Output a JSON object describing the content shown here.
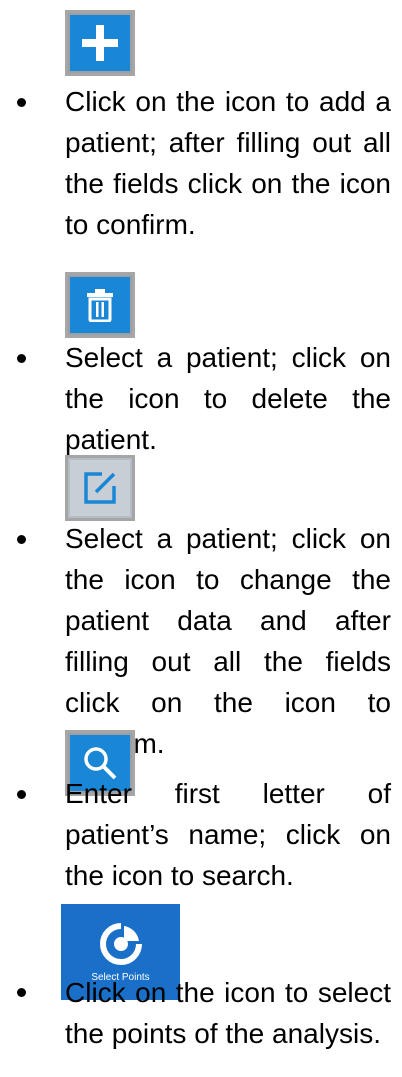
{
  "colors": {
    "icon_blue": "#1a87d6",
    "icon_blue_dark": "#1a6fc9",
    "icon_border": "#a6a6a6",
    "icon_light_bg": "#c7ced6"
  },
  "items": [
    {
      "icon": "plus-icon",
      "text": "Click on the icon to add a patient; after filling out all the fields click on the icon to confirm."
    },
    {
      "icon": "trash-icon",
      "text": "Select a patient; click on the icon to delete the patient."
    },
    {
      "icon": "edit-icon",
      "text": "Select a patient; click on the icon to change the patient data and after filling out all the fields click on the icon to confirm."
    },
    {
      "icon": "search-icon",
      "text": "Enter first letter of patient’s name; click on the icon to search."
    },
    {
      "icon": "select-points-icon",
      "icon_label": "Select Points",
      "text": "Click on the icon to select the points of the analysis."
    }
  ]
}
